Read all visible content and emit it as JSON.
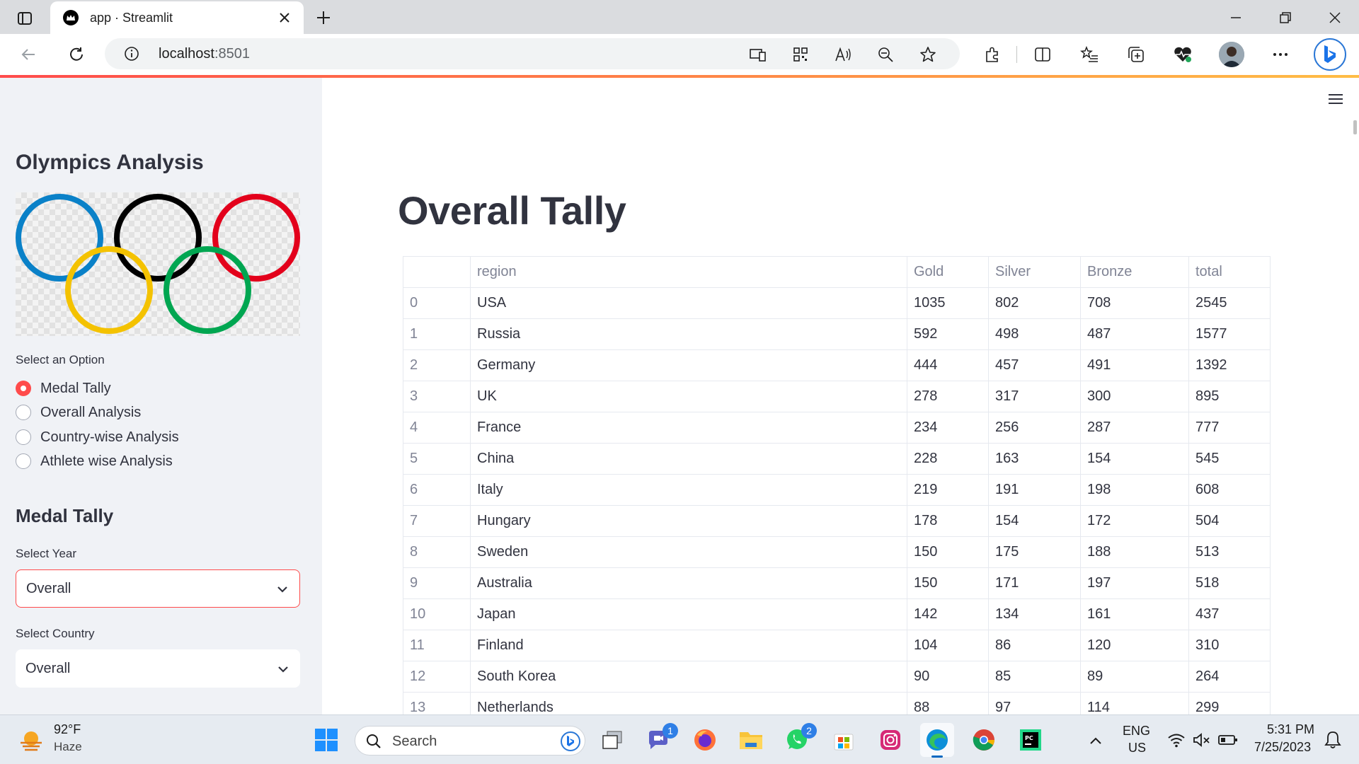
{
  "browser": {
    "tab_title": "app · Streamlit",
    "url_host": "localhost",
    "url_port": ":8501"
  },
  "sidebar": {
    "title": "Olympics Analysis",
    "option_label": "Select an Option",
    "options": [
      {
        "label": "Medal Tally",
        "selected": true
      },
      {
        "label": "Overall Analysis",
        "selected": false
      },
      {
        "label": "Country-wise Analysis",
        "selected": false
      },
      {
        "label": "Athlete wise Analysis",
        "selected": false
      }
    ],
    "section_title": "Medal Tally",
    "year_label": "Select Year",
    "year_value": "Overall",
    "country_label": "Select Country",
    "country_value": "Overall"
  },
  "main": {
    "title": "Overall Tally",
    "table": {
      "columns": [
        "",
        "region",
        "Gold",
        "Silver",
        "Bronze",
        "total"
      ],
      "rows": [
        [
          "0",
          "USA",
          "1035",
          "802",
          "708",
          "2545"
        ],
        [
          "1",
          "Russia",
          "592",
          "498",
          "487",
          "1577"
        ],
        [
          "2",
          "Germany",
          "444",
          "457",
          "491",
          "1392"
        ],
        [
          "3",
          "UK",
          "278",
          "317",
          "300",
          "895"
        ],
        [
          "4",
          "France",
          "234",
          "256",
          "287",
          "777"
        ],
        [
          "5",
          "China",
          "228",
          "163",
          "154",
          "545"
        ],
        [
          "6",
          "Italy",
          "219",
          "191",
          "198",
          "608"
        ],
        [
          "7",
          "Hungary",
          "178",
          "154",
          "172",
          "504"
        ],
        [
          "8",
          "Sweden",
          "150",
          "175",
          "188",
          "513"
        ],
        [
          "9",
          "Australia",
          "150",
          "171",
          "197",
          "518"
        ],
        [
          "10",
          "Japan",
          "142",
          "134",
          "161",
          "437"
        ],
        [
          "11",
          "Finland",
          "104",
          "86",
          "120",
          "310"
        ],
        [
          "12",
          "South Korea",
          "90",
          "85",
          "89",
          "264"
        ],
        [
          "13",
          "Netherlands",
          "88",
          "97",
          "114",
          "299"
        ]
      ]
    }
  },
  "taskbar": {
    "weather_temp": "92°F",
    "weather_desc": "Haze",
    "search_placeholder": "Search",
    "teams_badge": "1",
    "whatsapp_badge": "2",
    "lang_top": "ENG",
    "lang_bottom": "US",
    "time": "5:31 PM",
    "date": "7/25/2023"
  },
  "colors": {
    "accent": "#ff4b4b",
    "sidebar_bg": "#f0f2f6",
    "text": "#31333f",
    "muted": "#808495"
  }
}
